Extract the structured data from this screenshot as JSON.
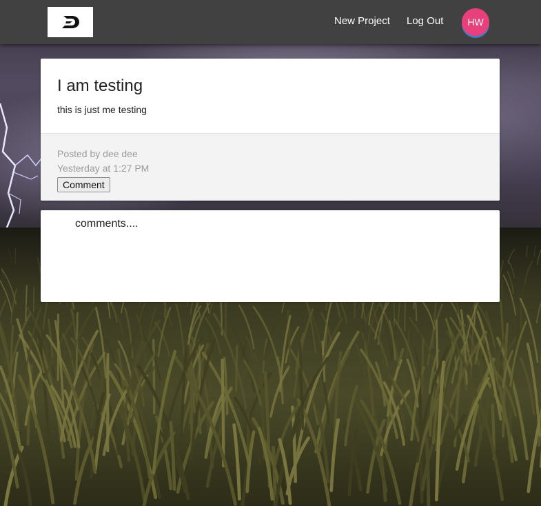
{
  "navbar": {
    "logo_icon": "brand-logo-d",
    "links": {
      "new_project": "New Project",
      "log_out": "Log Out"
    },
    "avatar_initials": "HW",
    "colors": {
      "navbar_bg": "#414141",
      "avatar_bg": "#e8407a",
      "avatar_accent": "#4a78c8"
    }
  },
  "post": {
    "title": "I am testing",
    "body": "this is just me testing",
    "posted_by": "Posted by dee dee",
    "timestamp": "Yesterday at 1:27 PM",
    "comment_button": "Comment"
  },
  "comments": {
    "label": "comments...."
  }
}
